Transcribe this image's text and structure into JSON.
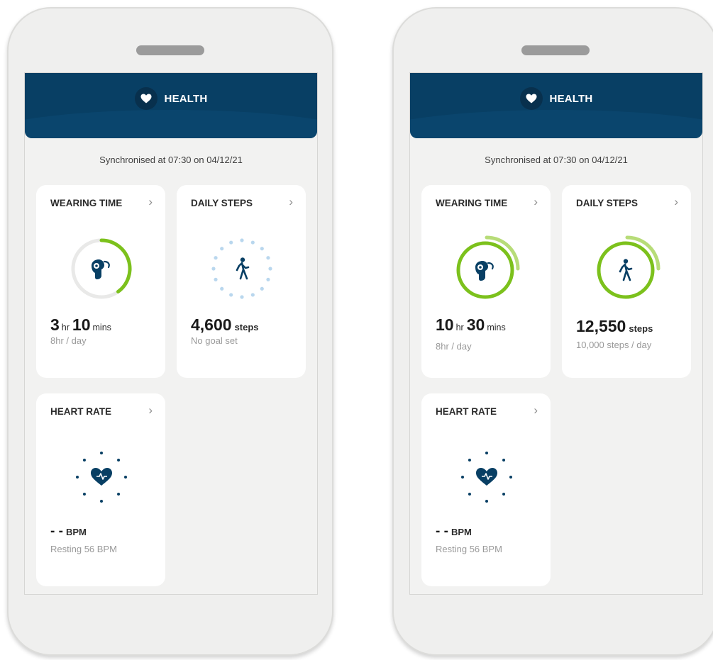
{
  "colors": {
    "header": "#083f64",
    "accent_green": "#7cc11c",
    "icon_navy": "#083f64",
    "dot_blue": "#b9d7ee"
  },
  "screens": [
    {
      "header_title": "HEALTH",
      "header_icon": "heart-icon",
      "sync_text": "Synchronised at 07:30 on 04/12/21",
      "wearing": {
        "title": "WEARING TIME",
        "hours": "3",
        "hr_unit": "hr",
        "mins": "10",
        "min_unit": "mins",
        "goal": "8hr / day",
        "icon": "hearing-aid-icon",
        "progress": 0.4
      },
      "steps": {
        "title": "DAILY STEPS",
        "value": "4,600",
        "unit": "steps",
        "goal": "No goal set",
        "icon": "walking-person-icon"
      },
      "heart": {
        "title": "HEART RATE",
        "value": "- -",
        "unit": "BPM",
        "resting": "Resting 56 BPM",
        "icon": "heart-icon"
      }
    },
    {
      "header_title": "HEALTH",
      "header_icon": "heart-icon",
      "sync_text": "Synchronised at 07:30 on 04/12/21",
      "wearing": {
        "title": "WEARING TIME",
        "hours": "10",
        "hr_unit": "hr",
        "mins": "30",
        "min_unit": "mins",
        "goal": "8hr / day",
        "icon": "hearing-aid-icon",
        "progress": 1.3
      },
      "steps": {
        "title": "DAILY STEPS",
        "value": "12,550",
        "unit": "steps",
        "goal": "10,000 steps / day",
        "icon": "walking-person-icon",
        "progress": 1.25
      },
      "heart": {
        "title": "HEART RATE",
        "value": "- -",
        "unit": "BPM",
        "resting": "Resting 56 BPM",
        "icon": "heart-icon"
      }
    }
  ]
}
